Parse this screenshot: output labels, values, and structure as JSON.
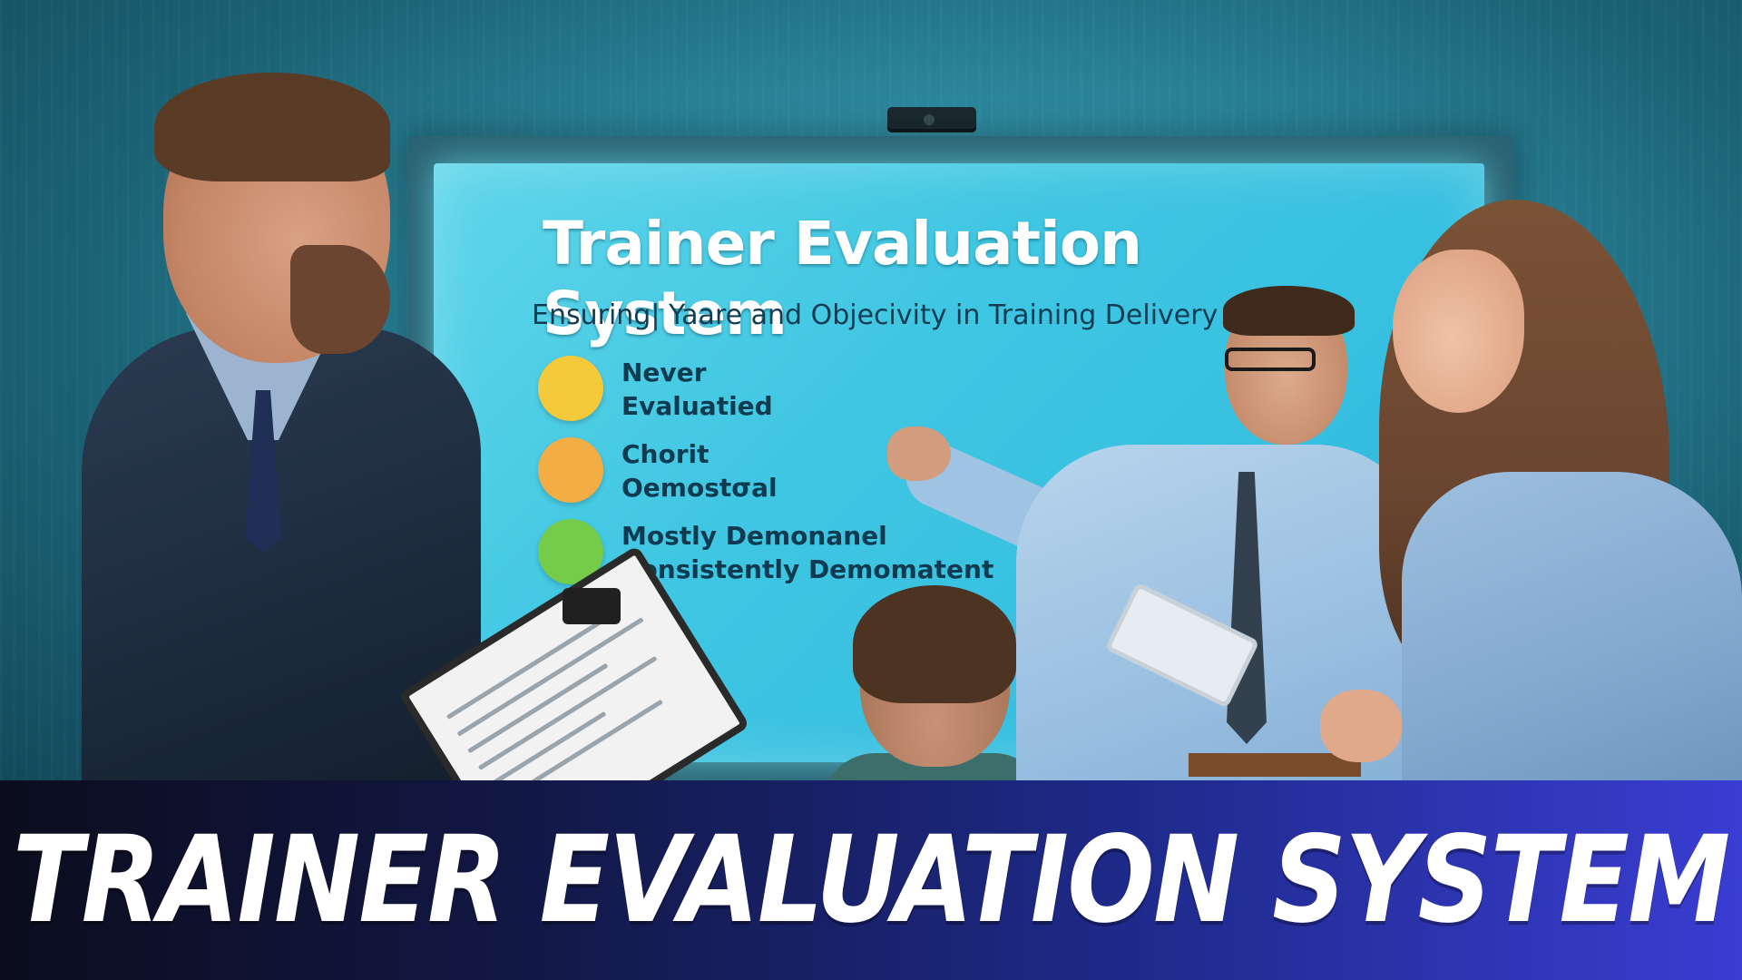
{
  "screen": {
    "title": "Trainer Evaluation System",
    "subtitle": "Ensuring| Yaare and Objecivity in Training Delivery",
    "legend": [
      {
        "line1": "Never",
        "line2": "Evaluatied",
        "color": "#f4c93a"
      },
      {
        "line1": "Chorit",
        "line2": "Oemostσal",
        "color": "#f2ae45"
      },
      {
        "line1": "Mostly Demonanel",
        "line2": "Consistently Demomatent",
        "color": "#74cc49"
      }
    ]
  },
  "banner": {
    "title": "TRAINER EVALUATION SYSTEM",
    "gradient_start": "#0b0d1e",
    "gradient_end": "#3a3dd2"
  }
}
